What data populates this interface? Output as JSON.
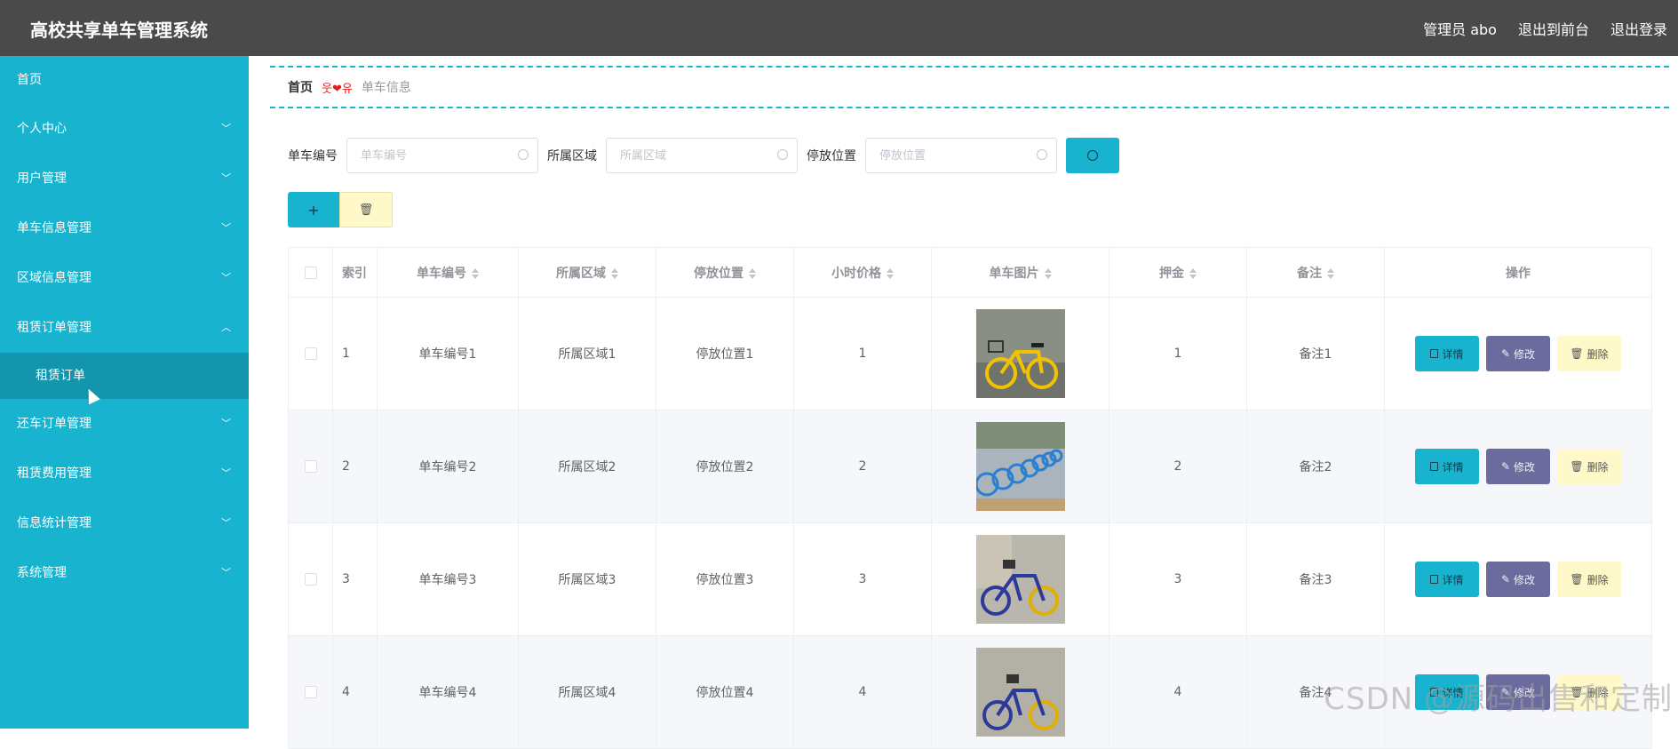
{
  "header": {
    "title": "高校共享单车管理系统",
    "admin": "管理员 abo",
    "back_front": "退出到前台",
    "logout": "退出登录"
  },
  "sidebar": {
    "home": "首页",
    "items": [
      {
        "label": "个人中心",
        "chevron": "v"
      },
      {
        "label": "用户管理",
        "chevron": "v"
      },
      {
        "label": "单车信息管理",
        "chevron": "v"
      },
      {
        "label": "区域信息管理",
        "chevron": "v"
      },
      {
        "label": "租赁订单管理",
        "chevron": "^"
      }
    ],
    "active_sub": "租赁订单",
    "items_after": [
      {
        "label": "还车订单管理",
        "chevron": "v"
      },
      {
        "label": "租赁费用管理",
        "chevron": "v"
      },
      {
        "label": "信息统计管理",
        "chevron": "v"
      },
      {
        "label": "系统管理",
        "chevron": "v"
      }
    ]
  },
  "breadcrumb": {
    "home": "首页",
    "separator": "웃❤유",
    "current": "单车信息"
  },
  "search": {
    "field1_label": "单车编号",
    "field1_placeholder": "单车编号",
    "field2_label": "所属区域",
    "field2_placeholder": "所属区域",
    "field3_label": "停放位置",
    "field3_placeholder": "停放位置"
  },
  "actions": {
    "add": "+",
    "delete_icon": "trash-icon"
  },
  "table": {
    "headers": {
      "index": "索引",
      "bike_no": "单车编号",
      "region": "所属区域",
      "location": "停放位置",
      "price": "小时价格",
      "image": "单车图片",
      "deposit": "押金",
      "note": "备注",
      "ops": "操作"
    },
    "op_labels": {
      "detail": "详情",
      "edit": "修改",
      "delete": "删除"
    },
    "rows": [
      {
        "index": "1",
        "bike_no": "单车编号1",
        "region": "所属区域1",
        "location": "停放位置1",
        "price": "1",
        "deposit": "1",
        "note": "备注1"
      },
      {
        "index": "2",
        "bike_no": "单车编号2",
        "region": "所属区域2",
        "location": "停放位置2",
        "price": "2",
        "deposit": "2",
        "note": "备注2"
      },
      {
        "index": "3",
        "bike_no": "单车编号3",
        "region": "所属区域3",
        "location": "停放位置3",
        "price": "3",
        "deposit": "3",
        "note": "备注3"
      },
      {
        "index": "4",
        "bike_no": "单车编号4",
        "region": "所属区域4",
        "location": "停放位置4",
        "price": "4",
        "deposit": "4",
        "note": "备注4"
      }
    ]
  },
  "watermark": "CSDN @源码出售和定制",
  "colors": {
    "accent": "#17b3cf",
    "header": "#4a4a4a",
    "edit": "#6b6b9e",
    "delete": "#fff9c9"
  }
}
